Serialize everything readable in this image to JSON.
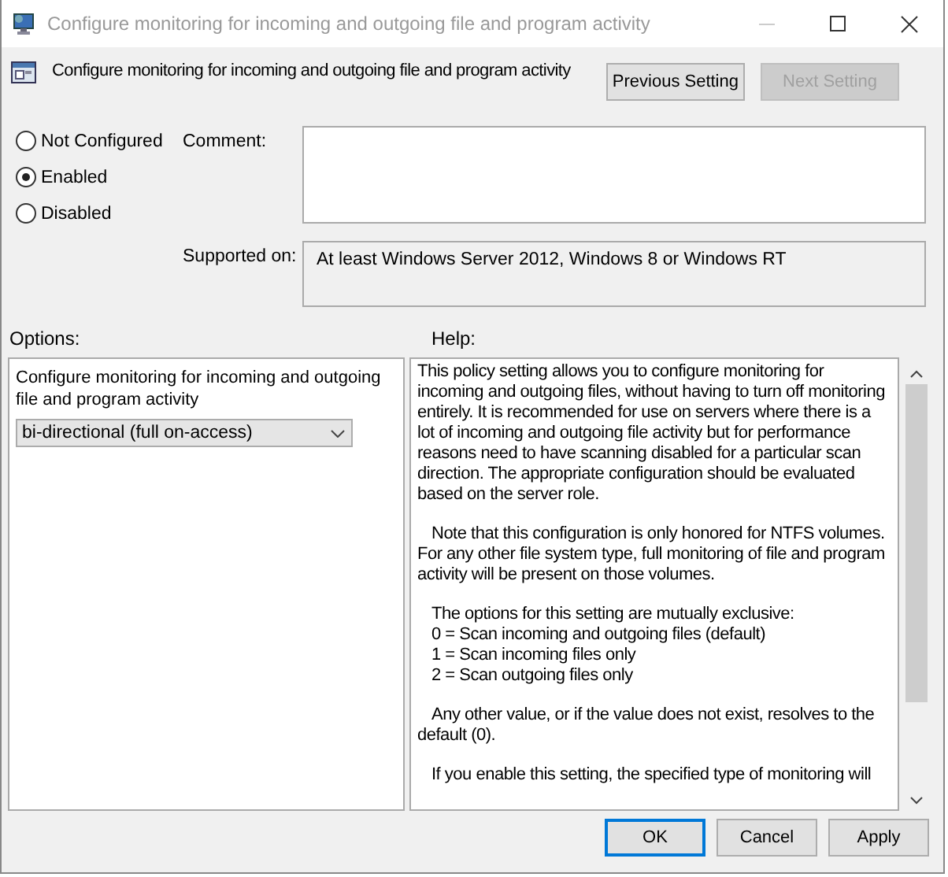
{
  "window": {
    "title": "Configure monitoring for incoming and outgoing file and program activity"
  },
  "header": {
    "title": "Configure monitoring for incoming and outgoing file and program activity"
  },
  "nav_buttons": [
    {
      "label": "Previous Setting",
      "disabled": false
    },
    {
      "label": "Next Setting",
      "disabled": true
    }
  ],
  "state_options": [
    {
      "label": "Not Configured",
      "selected": false
    },
    {
      "label": "Enabled",
      "selected": true
    },
    {
      "label": "Disabled",
      "selected": false
    }
  ],
  "comment": {
    "label": "Comment:"
  },
  "supported_on": {
    "label": "Supported on:",
    "value": "At least Windows Server 2012, Windows 8 or Windows RT"
  },
  "options": {
    "label": "Options:",
    "description": "Configure monitoring for incoming and outgoing file and program activity",
    "dropdown": "bi-directional (full on-access)"
  },
  "help": {
    "label": "Help:",
    "blocks": [
      {
        "kind": "para",
        "text": "This policy setting allows you to configure monitoring for incoming and outgoing files, without having to turn off monitoring entirely. It is recommended for use on servers where there is a lot of incoming and outgoing file activity but for performance reasons need to have scanning disabled for a particular scan direction. The appropriate configuration should be evaluated based on the server role."
      },
      {
        "kind": "indent",
        "text": "Note that this configuration is only honored for NTFS volumes. For any other file system type, full monitoring of file and program activity will be present on those volumes."
      },
      {
        "kind": "line",
        "text": "The options for this setting are mutually exclusive:"
      },
      {
        "kind": "line",
        "text": "0 = Scan incoming and outgoing files (default)"
      },
      {
        "kind": "line",
        "text": "1 = Scan incoming files only"
      },
      {
        "kind": "line",
        "text": "2 = Scan outgoing files only"
      },
      {
        "kind": "indent",
        "text": "Any other value, or if the value does not exist, resolves to the default (0)."
      },
      {
        "kind": "indent",
        "text": "If you enable this setting, the specified type of monitoring will"
      }
    ]
  },
  "footer_buttons": [
    {
      "label": "OK",
      "default": true
    },
    {
      "label": "Cancel",
      "default": false
    },
    {
      "label": "Apply",
      "default": false
    }
  ]
}
